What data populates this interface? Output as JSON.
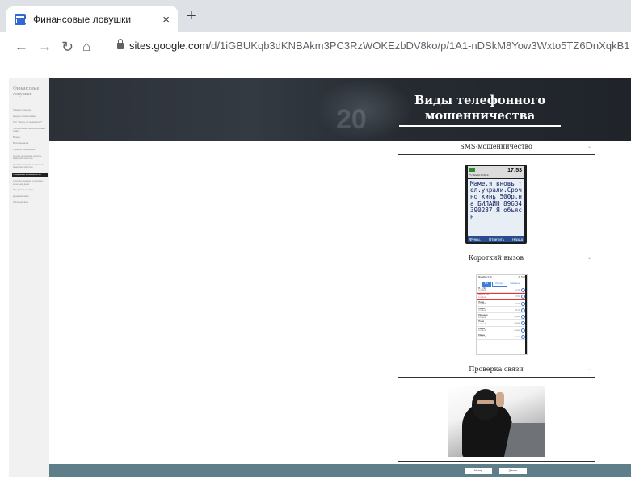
{
  "browser": {
    "tab_title": "Финансовые ловушки",
    "tab_close": "×",
    "new_tab": "+",
    "url_host": "sites.google.com",
    "url_path": "/d/1iGBUKqb3dKNBAkm3PC3RzWOKEzbDV8ko/p/1A1-nDSkM8Yow3Wxto5TZ6DnXqkB1ebuh/edit"
  },
  "sidebar": {
    "site_name": "Финансовые ловушки",
    "items": [
      "Главная страница",
      "Кредиты и микрозаймы",
      "Тест \"Делать ли бы кредиты?\"",
      "Прогрессивная шкала налоговых ставок",
      "Вклады",
      "Виды финансов",
      "Сервисы с финансами",
      "Ссылки на интернет-ресурсы банковских карточек",
      "Способы хищения из кошельков банковских карточек",
      "Телефонное мошенничество",
      "Способы хищения из интернет-кошельков денег",
      "Интерактивная карта",
      "Денежная тайна"
    ],
    "active_item": "Телефонное мошенничество",
    "extra_item": "Обратная связь"
  },
  "banner": {
    "title": "Виды телефонного мошенничества",
    "bg_digit": "20"
  },
  "sections": [
    {
      "label": "SMS-мошенничество"
    },
    {
      "label": "Короткий вызов"
    },
    {
      "label": "Проверка связи"
    }
  ],
  "chevron": "⌄",
  "phone": {
    "time": "17:53",
    "number": "+79220747813",
    "sms_text": "Маме,я вновь тел.украли.Срочно кинь 500р.на БИЛАЙН 89634390287.Я объясн",
    "menu_left": "Функц.",
    "menu_center": "Ответить",
    "menu_right": "Назад"
  },
  "calls": {
    "carrier": "МегаФон  9:58",
    "battery": "@ 71%",
    "tab_all": "Все",
    "tab_missed": "Пропущ.",
    "edit": "Изменить",
    "rows": [
      {
        "name": "П... (3)",
        "type": "сотовый",
        "time": "11:12",
        "highlight": false
      },
      {
        "name": "89963129...",
        "type": "сотовый",
        "time": "10:51",
        "highlight": true
      },
      {
        "name": "Папа",
        "type": "сотовый",
        "time": "10:34",
        "highlight": false
      },
      {
        "name": "Мама",
        "type": "сотовый",
        "time": "09:12",
        "highlight": false
      },
      {
        "name": "Мишаня",
        "type": "сотовый",
        "time": "вчера",
        "highlight": false
      },
      {
        "name": "Папа",
        "type": "сотовый",
        "time": "вчера",
        "highlight": false
      },
      {
        "name": "Мама",
        "type": "сотовый",
        "time": "вчера",
        "highlight": false
      },
      {
        "name": "Мама",
        "type": "сотовый",
        "time": "вчера",
        "highlight": false
      }
    ]
  },
  "footer": {
    "prev_label": "Назад",
    "next_label": "Далее"
  }
}
